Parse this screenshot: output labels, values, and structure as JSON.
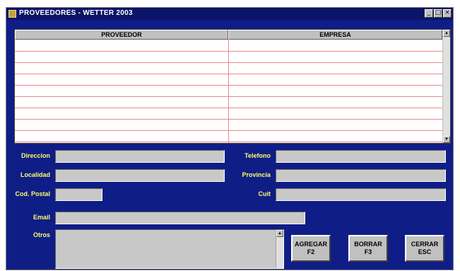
{
  "window": {
    "title": "PROVEEDORES - WETTER 2003",
    "controls": {
      "minimize": "_",
      "maximize": "□",
      "close": "×"
    }
  },
  "grid": {
    "columns": [
      "PROVEEDOR",
      "EMPRESA"
    ],
    "rows": [
      [
        "",
        ""
      ],
      [
        "",
        ""
      ],
      [
        "",
        ""
      ],
      [
        "",
        ""
      ],
      [
        "",
        ""
      ],
      [
        "",
        ""
      ],
      [
        "",
        ""
      ],
      [
        "",
        ""
      ],
      [
        "",
        ""
      ]
    ],
    "scroll_up": "▲",
    "scroll_down": "▼"
  },
  "form": {
    "direccion": {
      "label": "Direccion",
      "value": ""
    },
    "localidad": {
      "label": "Localidad",
      "value": ""
    },
    "cod_postal": {
      "label": "Cod. Postal",
      "value": ""
    },
    "email": {
      "label": "Email",
      "value": ""
    },
    "otros": {
      "label": "Otros",
      "value": ""
    },
    "telefono": {
      "label": "Telefono",
      "value": ""
    },
    "provincia": {
      "label": "Provincia",
      "value": ""
    },
    "cuit": {
      "label": "Cuit",
      "value": ""
    }
  },
  "buttons": {
    "agregar": {
      "line1": "AGREGAR",
      "line2": "F2"
    },
    "borrar": {
      "line1": "BORRAR",
      "line2": "F3"
    },
    "cerrar": {
      "line1": "CERRAR",
      "line2": "ESC"
    }
  },
  "colors": {
    "window_bg": "#0f1d87",
    "label": "#ffff66",
    "grid_line": "#e98a8a",
    "field_bg": "#c8c8c8"
  }
}
